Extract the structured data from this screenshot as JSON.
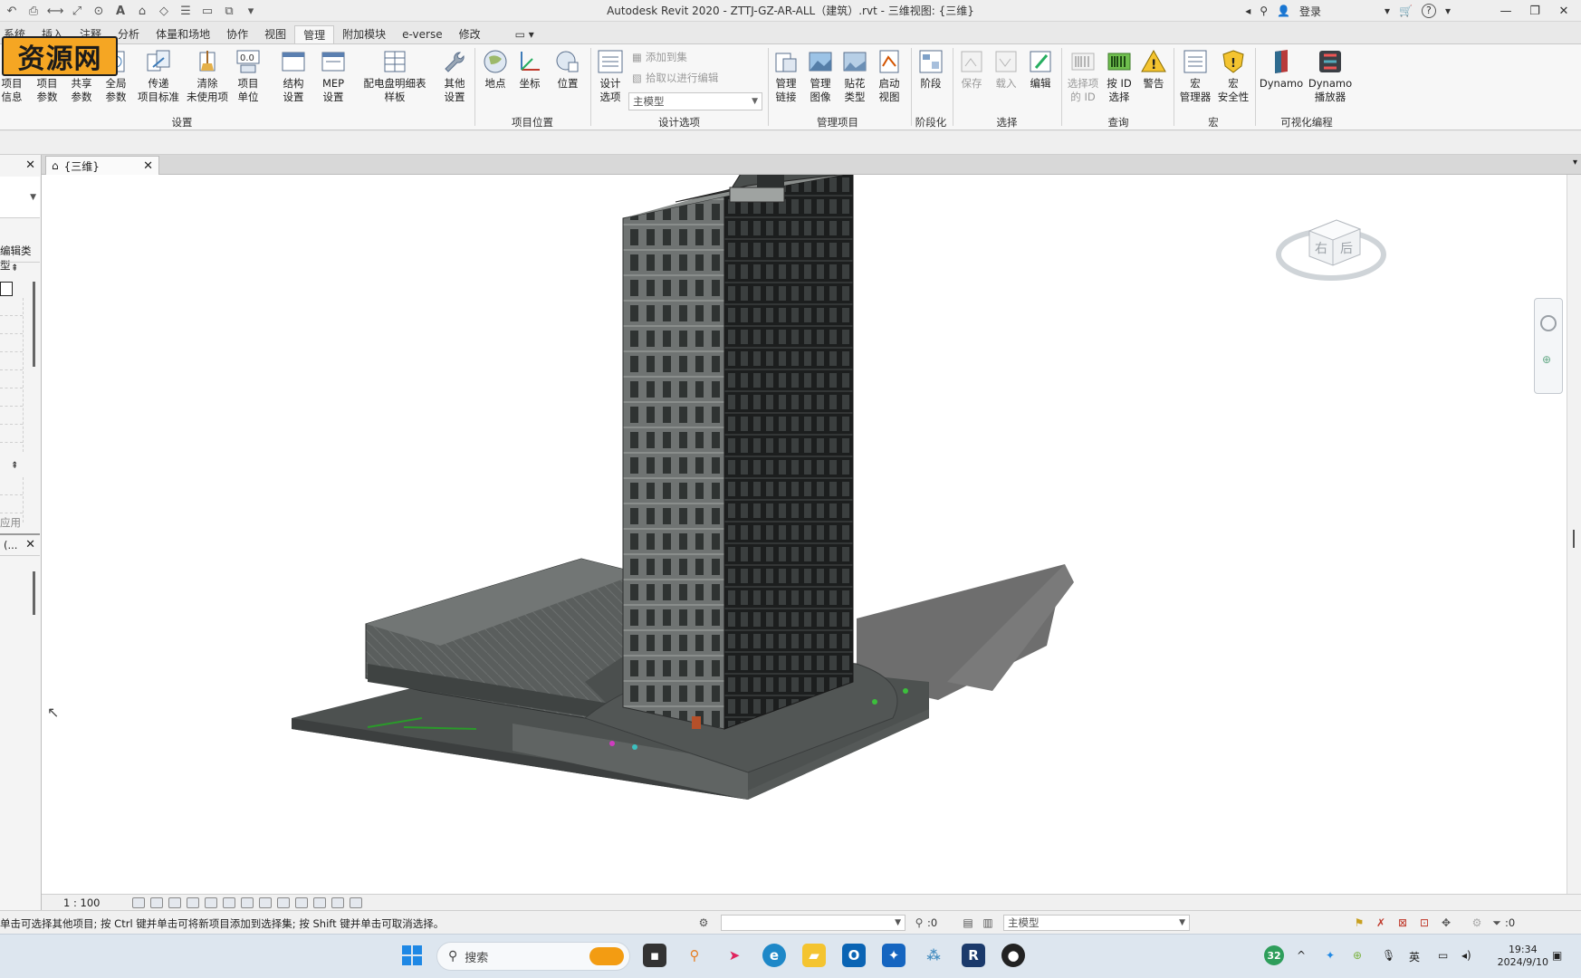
{
  "window": {
    "title": "Autodesk Revit 2020 - ZTTJ-GZ-AR-ALL（建筑）.rvt - 三维视图: {三维}",
    "login_label": "登录",
    "help_label": "?"
  },
  "watermark": {
    "text": "资源网"
  },
  "ribbon_tabs": [
    "分析",
    "体量和场地",
    "协作",
    "视图",
    "管理",
    "附加模块",
    "e-verse",
    "修改"
  ],
  "ribbon_tabs_partial": [
    "系统",
    "插入",
    "注释"
  ],
  "ribbon": {
    "settings": {
      "title": "设置",
      "buttons": [
        "项目\n信息",
        "项目\n参数",
        "共享\n参数",
        "全局\n参数",
        "传递\n项目标准",
        "清除\n未使用项",
        "项目\n单位",
        "结构\n设置",
        "MEP\n设置",
        "配电盘明细表\n样板",
        "其他\n设置"
      ]
    },
    "project_location": {
      "title": "项目位置",
      "buttons": [
        "地点",
        "坐标",
        "位置"
      ]
    },
    "design_options": {
      "title": "设计选项",
      "button": "设计\n选项",
      "add_to_set": "添加到集",
      "pick_to_edit": "拾取以进行编辑",
      "combo_value": "主模型"
    },
    "manage_project": {
      "title": "管理项目",
      "buttons": [
        "管理\n链接",
        "管理\n图像",
        "贴花\n类型",
        "启动\n视图"
      ]
    },
    "phasing": {
      "title": "阶段化",
      "button": "阶段"
    },
    "selection": {
      "title": "选择",
      "buttons": [
        "保存",
        "载入",
        "编辑"
      ]
    },
    "inquiry": {
      "title": "查询",
      "buttons": [
        "选择项\n的 ID",
        "按 ID\n选择",
        "警告"
      ]
    },
    "macros": {
      "title": "宏",
      "buttons": [
        "宏\n管理器",
        "宏\n安全性"
      ]
    },
    "visual_programming": {
      "title": "可视化编程",
      "buttons": [
        "Dynamo",
        "Dynamo\n播放器"
      ]
    }
  },
  "left_panel": {
    "type_label": "编辑类型",
    "apply_label": "应用",
    "browser_label": "(..."
  },
  "view_tab": {
    "label": "{三维}"
  },
  "viewcube": {
    "right": "右",
    "back": "后"
  },
  "view_control": {
    "scale": "1 : 100"
  },
  "status": {
    "message": "单击可选择其他项目; 按 Ctrl 键并单击可将新项目添加到选择集; 按 Shift 键并单击可取消选择。",
    "select_count": ":0",
    "model_combo": "主模型",
    "filter_count": ":0"
  },
  "taskbar": {
    "search_placeholder": "搜索",
    "notification_count": "32",
    "ime": "英",
    "time": "19:34",
    "date": "2024/9/10"
  }
}
